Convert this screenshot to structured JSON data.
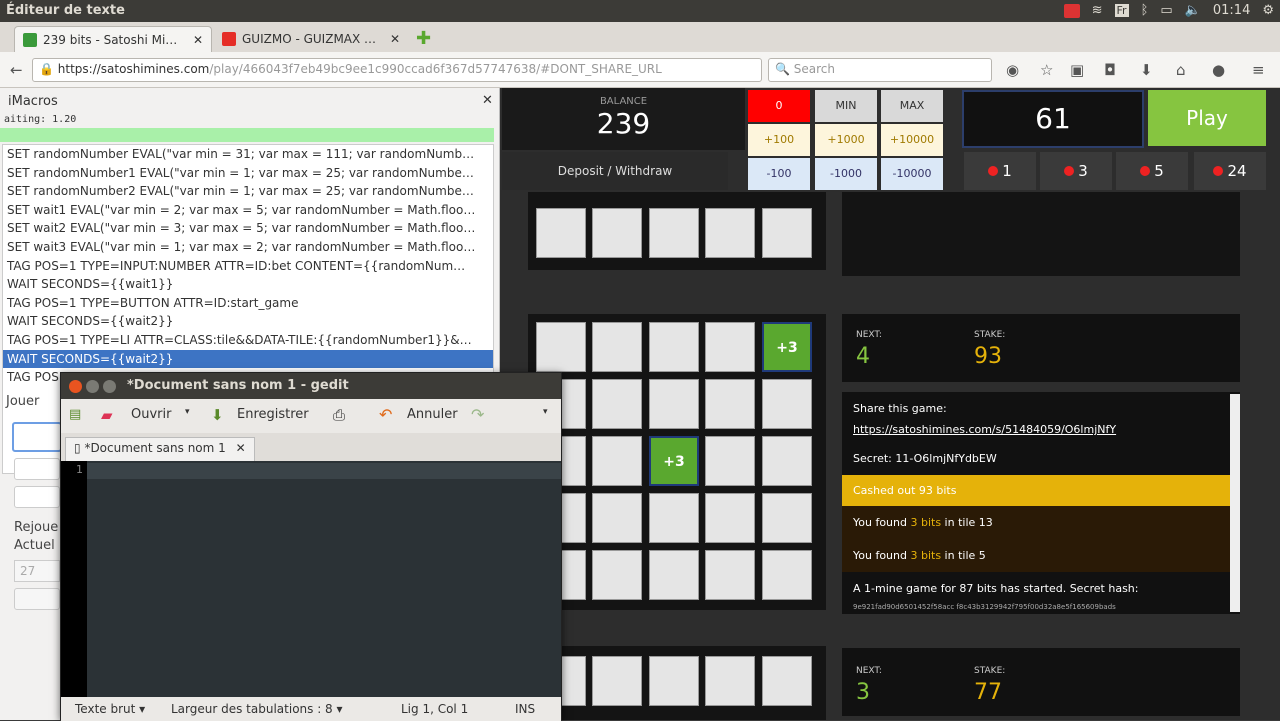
{
  "os": {
    "window_title": "Éditeur de texte",
    "clock": "01:14",
    "keyboard": "Fr"
  },
  "browser": {
    "tabs": [
      {
        "label": "239 bits - Satoshi Mi…",
        "color": "#3a9a3a"
      },
      {
        "label": "GUIZMO - GUIZMAX …",
        "color": "#e52d27"
      }
    ],
    "url_host": "https://satoshimines.com",
    "url_path": "/play/466043f7eb49bc9ee1c990ccad6f367d57747638/#DONT_SHARE_URL",
    "search_placeholder": "Search"
  },
  "imacros": {
    "title": "iMacros",
    "waiting": "aiting: 1.20",
    "lines": [
      "SET randomNumber EVAL(\"var min = 31; var max = 111; var randomNumb…",
      "SET randomNumber1 EVAL(\"var min = 1; var max = 25; var randomNumbe…",
      "SET randomNumber2 EVAL(\"var min = 1; var max = 25; var randomNumbe…",
      "SET wait1 EVAL(\"var min = 2; var max = 5; var randomNumber = Math.floo…",
      "SET wait2 EVAL(\"var min = 3; var max = 5; var randomNumber = Math.floo…",
      "SET wait3 EVAL(\"var min = 1; var max = 2; var randomNumber = Math.floo…",
      "TAG POS=1 TYPE=INPUT:NUMBER ATTR=ID:bet CONTENT={{randomNum…",
      "WAIT SECONDS={{wait1}}",
      "TAG POS=1 TYPE=BUTTON ATTR=ID:start_game",
      "WAIT SECONDS={{wait2}}",
      "TAG POS=1 TYPE=LI ATTR=CLASS:tile&&DATA-TILE:{{randomNumber1}}&…",
      "WAIT SECONDS={{wait2}}",
      "TAG POS…"
    ],
    "selected_index": 11,
    "play_label": "Jouer",
    "replay_label": "Rejoue",
    "current_label": "Actuel",
    "counter": "27"
  },
  "game": {
    "balance_label": "BALANCE",
    "balance": "239",
    "deposit": "Deposit / Withdraw",
    "bet_red": "0",
    "min": "MIN",
    "max": "MAX",
    "plus": [
      "+100",
      "+1000",
      "+10000"
    ],
    "minus": [
      "-100",
      "-1000",
      "-10000"
    ],
    "bet_value": "61",
    "play": "Play",
    "mines": [
      "1",
      "3",
      "5",
      "24"
    ],
    "tile_win": "+3",
    "g1": {
      "next_label": "NEXT:",
      "next": "4",
      "stake_label": "STAKE:",
      "stake": "93"
    },
    "g2": {
      "next_label": "NEXT:",
      "next": "3",
      "stake_label": "STAKE:",
      "stake": "77"
    },
    "chat": {
      "share_label": "Share this game:",
      "share_url": "https://satoshimines.com/s/51484059/O6lmjNfY",
      "secret": "Secret: 11-O6lmjNfYdbEW",
      "cashed": "Cashed out 93 bits",
      "found1_pre": "You found ",
      "found1_hl": "3 bits",
      "found1_post": " in tile 13",
      "found2_pre": "You found ",
      "found2_hl": "3 bits",
      "found2_post": " in tile 5",
      "newgame": "A 1-mine game for 87 bits has started. Secret hash:",
      "hash": "9e921fad90d6501452f58acc f8c43b3129942f795f00d32a8e5f165609bads"
    }
  },
  "gedit": {
    "title": "*Document sans nom 1 - gedit",
    "open": "Ouvrir",
    "save": "Enregistrer",
    "undo": "Annuler",
    "tab": "*Document sans nom 1",
    "line_no": "1",
    "status_text": "Texte brut",
    "tabs_width": "Largeur des tabulations : 8",
    "pos": "Lig 1, Col 1",
    "mode": "INS"
  }
}
